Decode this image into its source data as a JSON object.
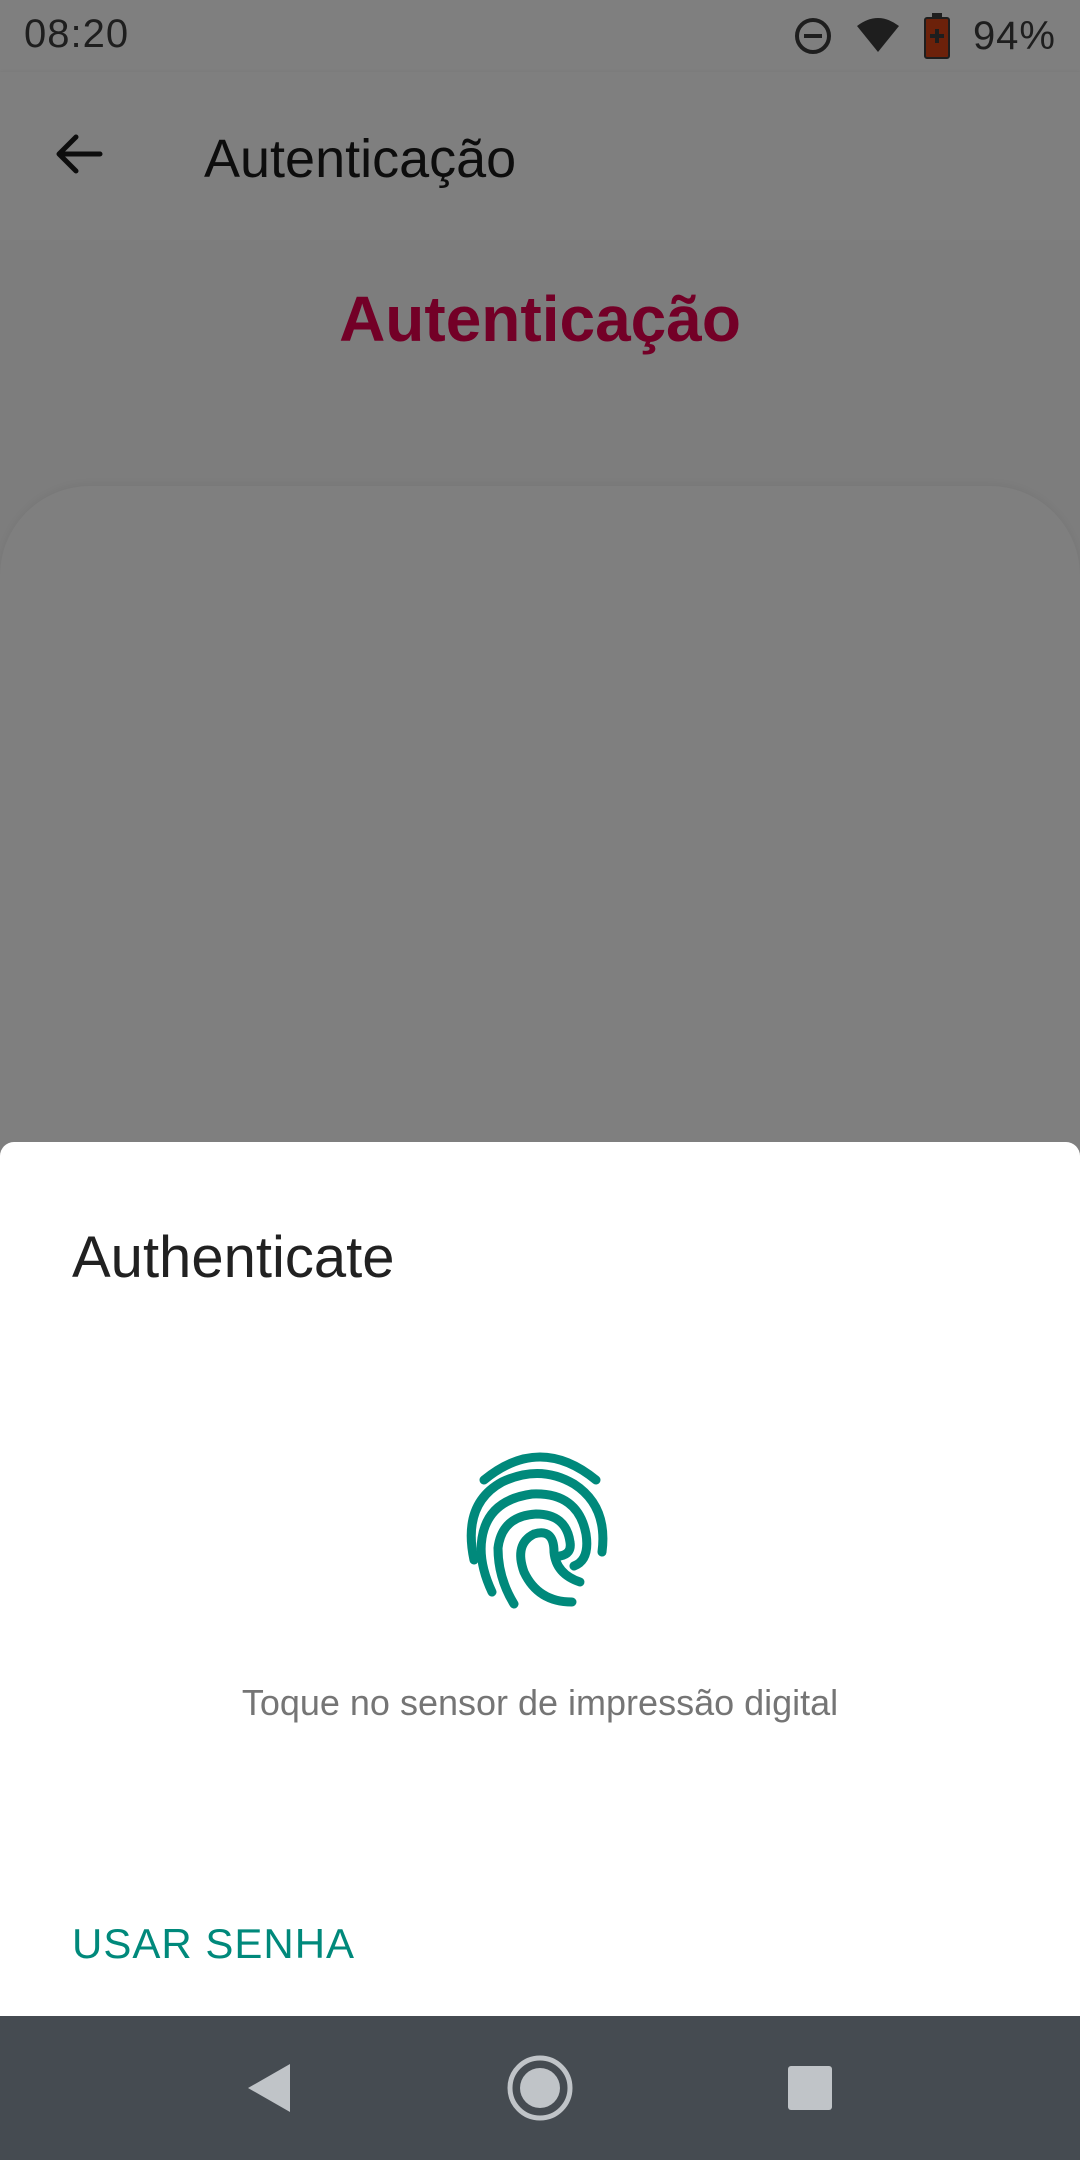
{
  "status_bar": {
    "time": "08:20",
    "battery_percent": "94%",
    "icons": [
      "do-not-disturb-icon",
      "wifi-icon",
      "battery-icon"
    ]
  },
  "app_bar": {
    "title": "Autenticação",
    "back_icon": "arrow-back-icon"
  },
  "content": {
    "heading": "Autenticação"
  },
  "dialog": {
    "title": "Authenticate",
    "icon": "fingerprint-icon",
    "hint": "Toque no sensor de impressão digital",
    "use_password_label": "USAR SENHA"
  },
  "nav_bar": {
    "buttons": [
      "back-icon",
      "home-icon",
      "recents-icon"
    ]
  },
  "colors": {
    "accent": "#e6004e",
    "teal": "#00897b",
    "nav_bar": "#454b51",
    "scrim": "rgba(0,0,0,0.5)"
  }
}
